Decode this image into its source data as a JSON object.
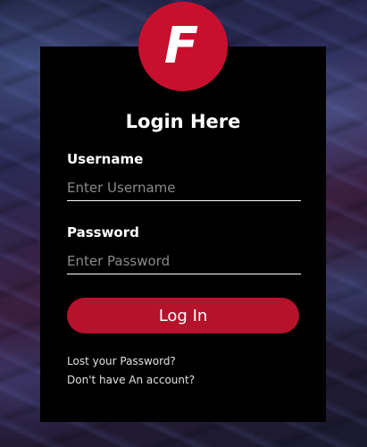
{
  "logo": {
    "letter": "F",
    "color": "#c8102e"
  },
  "form": {
    "title": "Login Here",
    "username": {
      "label": "Username",
      "placeholder": "Enter Username",
      "value": ""
    },
    "password": {
      "label": "Password",
      "placeholder": "Enter Password",
      "value": ""
    },
    "submit_label": "Log In",
    "forgot_link": "Lost your Password?",
    "signup_link": "Don't have An account?"
  },
  "colors": {
    "accent": "#b5122b",
    "panel": "#000000"
  }
}
